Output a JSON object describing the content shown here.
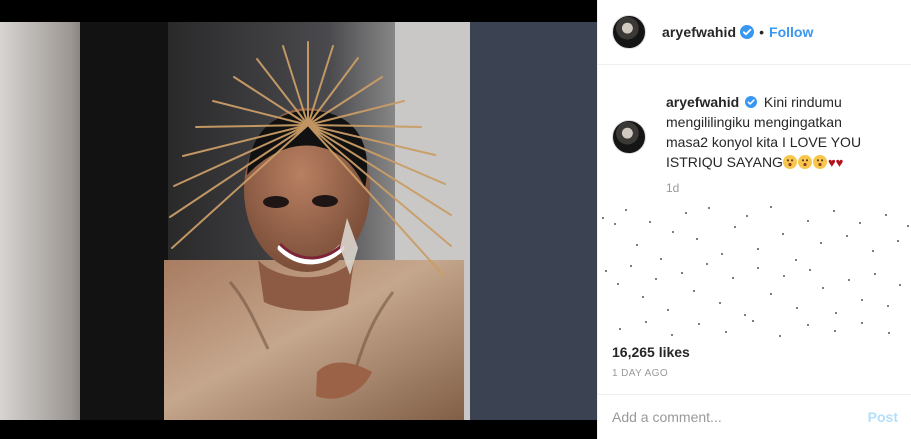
{
  "post": {
    "username": "aryefwahid",
    "follow_label": "Follow",
    "dot": "•",
    "caption_text_prefix": "Kini rindumu mengililingiku mengingatkan masa2 konyol kita I LOVE YOU ISTRIQU SAYANG",
    "hearts": "♥♥",
    "caption_age": "1d",
    "likes": "16,265 likes",
    "posted_time": "1 DAY AGO",
    "comment_placeholder": "Add a comment...",
    "post_label": "Post"
  },
  "icons": {
    "verified": "verified-badge-icon",
    "emoji": "astonished-face-icon",
    "heart": "red-heart-icon"
  },
  "colors": {
    "accent": "#3897f0",
    "verified": "#3897f0",
    "heart": "#b4121f",
    "muted": "#999999"
  }
}
